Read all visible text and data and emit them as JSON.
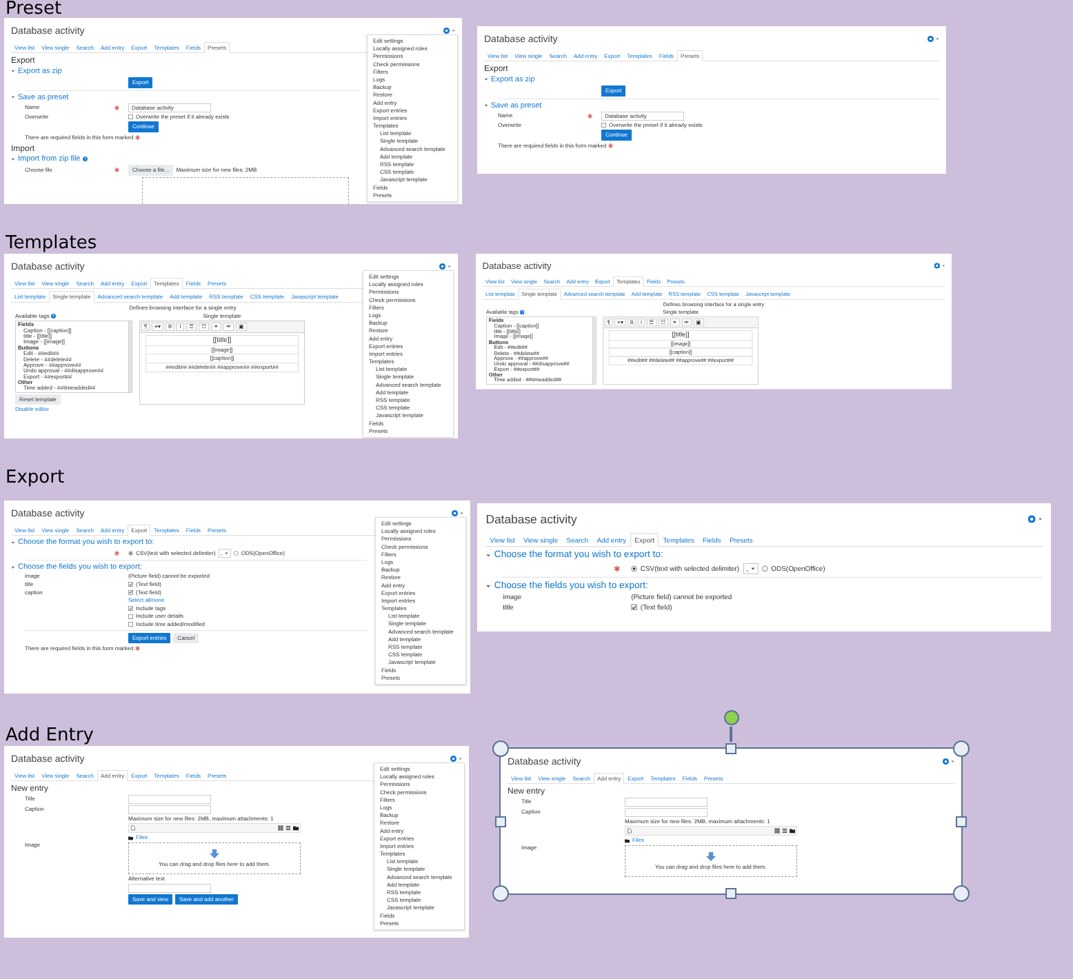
{
  "sections": [
    {
      "heading": "Preset",
      "shots": [
        {
          "title": "Database activity",
          "selected": false,
          "tabs": [
            {
              "label": "View list",
              "selected": false
            },
            {
              "label": "View single",
              "selected": false
            },
            {
              "label": "Search",
              "selected": false
            },
            {
              "label": "Add entry",
              "selected": false
            },
            {
              "label": "Export",
              "selected": false
            },
            {
              "label": "Templates",
              "selected": false
            },
            {
              "label": "Fields",
              "selected": false
            },
            {
              "label": "Presets",
              "selected": true
            }
          ],
          "blocks": [
            {
              "kind": "heading",
              "text": "Export"
            },
            {
              "kind": "section",
              "text": "Export as zip"
            },
            {
              "kind": "buttons",
              "buttons": [
                {
                  "label": "Export",
                  "primary": true
                }
              ]
            },
            {
              "kind": "divider"
            },
            {
              "kind": "section",
              "text": "Save as preset"
            },
            {
              "kind": "field",
              "label": "Name",
              "required": true,
              "value": "Database activity"
            },
            {
              "kind": "checkbox",
              "label": "Overwrite",
              "text": "Overwrite the preset if it already exists",
              "checked": false
            },
            {
              "kind": "buttons",
              "buttons": [
                {
                  "label": "Continue",
                  "primary": true
                }
              ]
            },
            {
              "kind": "note",
              "text": "There are required fields in this form marked"
            },
            {
              "kind": "heading",
              "text": "Import"
            },
            {
              "kind": "section",
              "text": "Import from zip file",
              "help": true
            },
            {
              "kind": "file",
              "label": "Choose file",
              "required": true,
              "button": "Choose a file...",
              "text": "Maximum size for new files: 2MB"
            },
            {
              "kind": "dropzone"
            }
          ],
          "menu": [
            {
              "label": "Edit settings"
            },
            {
              "label": "Locally assigned roles"
            },
            {
              "label": "Permissions"
            },
            {
              "label": "Check permissions"
            },
            {
              "label": "Filters"
            },
            {
              "label": "Logs"
            },
            {
              "label": "Backup"
            },
            {
              "label": "Restore"
            },
            {
              "label": "Add entry"
            },
            {
              "label": "Export entries"
            },
            {
              "label": "Import entries"
            },
            {
              "label": "Templates",
              "children": [
                {
                  "label": "List template"
                },
                {
                  "label": "Single template"
                },
                {
                  "label": "Advanced search template"
                },
                {
                  "label": "Add template"
                },
                {
                  "label": "RSS template"
                },
                {
                  "label": "CSS template"
                },
                {
                  "label": "Javascript template"
                }
              ]
            },
            {
              "label": "Fields"
            },
            {
              "label": "Presets"
            }
          ]
        },
        {
          "title": "Database activity",
          "selected": false,
          "tabs": [
            {
              "label": "View list",
              "selected": false
            },
            {
              "label": "View single",
              "selected": false
            },
            {
              "label": "Search",
              "selected": false
            },
            {
              "label": "Add entry",
              "selected": false
            },
            {
              "label": "Export",
              "selected": false
            },
            {
              "label": "Templates",
              "selected": false
            },
            {
              "label": "Fields",
              "selected": false
            },
            {
              "label": "Presets",
              "selected": true
            }
          ],
          "blocks": [
            {
              "kind": "heading",
              "text": "Export"
            },
            {
              "kind": "section",
              "text": "Export as zip"
            },
            {
              "kind": "buttons",
              "buttons": [
                {
                  "label": "Export",
                  "primary": true
                }
              ]
            },
            {
              "kind": "divider"
            },
            {
              "kind": "section",
              "text": "Save as preset"
            },
            {
              "kind": "field",
              "label": "Name",
              "required": true,
              "value": "Database activity"
            },
            {
              "kind": "checkbox",
              "label": "Overwrite",
              "text": "Overwrite the preset if it already exists",
              "checked": false
            },
            {
              "kind": "buttons",
              "buttons": [
                {
                  "label": "Continue",
                  "primary": true
                }
              ]
            },
            {
              "kind": "note",
              "text": "There are required fields in this form marked"
            }
          ]
        }
      ]
    },
    {
      "heading": "Templates",
      "shots": [
        {
          "title": "Database activity",
          "selected": false,
          "tabs": [
            {
              "label": "View list",
              "selected": false
            },
            {
              "label": "View single",
              "selected": false
            },
            {
              "label": "Search",
              "selected": false
            },
            {
              "label": "Add entry",
              "selected": false
            },
            {
              "label": "Export",
              "selected": false
            },
            {
              "label": "Templates",
              "selected": true
            },
            {
              "label": "Fields",
              "selected": false
            },
            {
              "label": "Presets",
              "selected": false
            }
          ],
          "subtabs": [
            {
              "label": "List template",
              "selected": false
            },
            {
              "label": "Single template",
              "selected": true
            },
            {
              "label": "Advanced search template",
              "selected": false
            },
            {
              "label": "Add template",
              "selected": false
            },
            {
              "label": "RSS template",
              "selected": false
            },
            {
              "label": "CSS template",
              "selected": false
            },
            {
              "label": "Javascript template",
              "selected": false
            }
          ],
          "blocks": [
            {
              "kind": "text",
              "text": "Defines browsing interface for a single entry"
            },
            {
              "kind": "template-editor",
              "tags_label": "Available tags",
              "tag_groups": [
                {
                  "name": "Fields",
                  "tags": [
                    "Caption - [[caption]]",
                    "title - [[title]]",
                    "Image - [[image]]"
                  ]
                },
                {
                  "name": "Buttons",
                  "tags": [
                    "Edit - ##edit##",
                    "Delete - ##delete##",
                    "Approve - ##approve##",
                    "Undo approval - ##disapprove##",
                    "Export - ##export##"
                  ]
                },
                {
                  "name": "Other",
                  "tags": [
                    "Time added - ##timeadded##"
                  ]
                }
              ],
              "editor_label": "Single template",
              "toolbar": [
                "¶",
                "≡▾",
                "B",
                "I",
                "☰",
                "☷",
                "⚭",
                "⚮",
                "▣"
              ],
              "lines": [
                "[[title]]",
                "[[image]]",
                "[[caption]]",
                "##edit## ##delete## ##approve## ##export##"
              ],
              "reset_button": "Reset template"
            },
            {
              "kind": "link",
              "text": "Disable editor"
            }
          ],
          "menu": [
            {
              "label": "Edit settings"
            },
            {
              "label": "Locally assigned roles"
            },
            {
              "label": "Permissions"
            },
            {
              "label": "Check permissions"
            },
            {
              "label": "Filters"
            },
            {
              "label": "Logs"
            },
            {
              "label": "Backup"
            },
            {
              "label": "Restore"
            },
            {
              "label": "Add entry"
            },
            {
              "label": "Export entries"
            },
            {
              "label": "Import entries"
            },
            {
              "label": "Templates",
              "children": [
                {
                  "label": "List template"
                },
                {
                  "label": "Single template"
                },
                {
                  "label": "Advanced search template"
                },
                {
                  "label": "Add template"
                },
                {
                  "label": "RSS template"
                },
                {
                  "label": "CSS template"
                },
                {
                  "label": "Javascript template"
                }
              ]
            },
            {
              "label": "Fields"
            },
            {
              "label": "Presets"
            }
          ]
        },
        {
          "title": "Database activity",
          "selected": false,
          "tabs": [
            {
              "label": "View list",
              "selected": false
            },
            {
              "label": "View single",
              "selected": false
            },
            {
              "label": "Search",
              "selected": false
            },
            {
              "label": "Add entry",
              "selected": false
            },
            {
              "label": "Export",
              "selected": false
            },
            {
              "label": "Templates",
              "selected": true
            },
            {
              "label": "Fields",
              "selected": false
            },
            {
              "label": "Presets",
              "selected": false
            }
          ],
          "subtabs": [
            {
              "label": "List template",
              "selected": false
            },
            {
              "label": "Single template",
              "selected": true
            },
            {
              "label": "Advanced search template",
              "selected": false
            },
            {
              "label": "Add template",
              "selected": false
            },
            {
              "label": "RSS template",
              "selected": false
            },
            {
              "label": "CSS template",
              "selected": false
            },
            {
              "label": "Javascript template",
              "selected": false
            }
          ],
          "blocks": [
            {
              "kind": "text",
              "text": "Defines browsing interface for a single entry"
            },
            {
              "kind": "template-editor",
              "tags_label": "Available tags",
              "tag_groups": [
                {
                  "name": "Fields",
                  "tags": [
                    "Caption - [[caption]]",
                    "title - [[title]]",
                    "Image - [[image]]"
                  ]
                },
                {
                  "name": "Buttons",
                  "tags": [
                    "Edit - ##edit##",
                    "Delete - ##delete##",
                    "Approve - ##approve##",
                    "Undo approval - ##disapprove##",
                    "Export - ##export##"
                  ]
                },
                {
                  "name": "Other",
                  "tags": [
                    "Time added - ##timeadded##"
                  ]
                }
              ],
              "editor_label": "Single template",
              "toolbar": [
                "¶",
                "≡▾",
                "B",
                "I",
                "☰",
                "☷",
                "⚭",
                "⚮",
                "▣"
              ],
              "lines": [
                "[[title]]",
                "[[image]]",
                "[[caption]]",
                "##edit## ##delete## ##approve## ##export##"
              ]
            }
          ]
        }
      ]
    },
    {
      "heading": "Export",
      "shots": [
        {
          "title": "Database activity",
          "selected": false,
          "tabs": [
            {
              "label": "View list",
              "selected": false
            },
            {
              "label": "View single",
              "selected": false
            },
            {
              "label": "Search",
              "selected": false
            },
            {
              "label": "Add entry",
              "selected": false
            },
            {
              "label": "Export",
              "selected": true
            },
            {
              "label": "Templates",
              "selected": false
            },
            {
              "label": "Fields",
              "selected": false
            },
            {
              "label": "Presets",
              "selected": false
            }
          ],
          "blocks": [
            {
              "kind": "section",
              "text": "Choose the format you wish to export to:"
            },
            {
              "kind": "format",
              "required": true,
              "options": [
                {
                  "label": "CSV(text with selected delimiter)",
                  "selected": true
                },
                {
                  "label": "ODS(OpenOffice)",
                  "selected": false
                }
              ],
              "delimiter": ","
            },
            {
              "kind": "divider"
            },
            {
              "kind": "section",
              "text": "Choose the fields you wish to export:"
            },
            {
              "kind": "info",
              "label": "image",
              "text": "(Picture field) cannot be exported"
            },
            {
              "kind": "checkbox",
              "label": "title",
              "text": "(Text field)",
              "checked": true
            },
            {
              "kind": "checkbox",
              "label": "caption",
              "text": "(Text field)",
              "checked": true
            },
            {
              "kind": "form-link",
              "text": "Select all/none"
            },
            {
              "kind": "checkbox",
              "text": "Include tags",
              "checked": true
            },
            {
              "kind": "checkbox",
              "text": "Include user details",
              "checked": false
            },
            {
              "kind": "checkbox",
              "text": "Include time added/modified",
              "checked": false
            },
            {
              "kind": "divider"
            },
            {
              "kind": "buttons",
              "buttons": [
                {
                  "label": "Export entries",
                  "primary": true
                },
                {
                  "label": "Cancel",
                  "primary": false
                }
              ]
            },
            {
              "kind": "note",
              "text": "There are required fields in this form marked"
            }
          ],
          "menu": [
            {
              "label": "Edit settings"
            },
            {
              "label": "Locally assigned roles"
            },
            {
              "label": "Permissions"
            },
            {
              "label": "Check permissions"
            },
            {
              "label": "Filters"
            },
            {
              "label": "Logs"
            },
            {
              "label": "Backup"
            },
            {
              "label": "Restore"
            },
            {
              "label": "Add entry"
            },
            {
              "label": "Export entries"
            },
            {
              "label": "Import entries"
            },
            {
              "label": "Templates",
              "children": [
                {
                  "label": "List template"
                },
                {
                  "label": "Single template"
                },
                {
                  "label": "Advanced search template"
                },
                {
                  "label": "Add template"
                },
                {
                  "label": "RSS template"
                },
                {
                  "label": "CSS template"
                },
                {
                  "label": "Javascript template"
                }
              ]
            },
            {
              "label": "Fields"
            },
            {
              "label": "Presets"
            }
          ]
        },
        {
          "title": "Database activity",
          "selected": false,
          "tabs": [
            {
              "label": "View list",
              "selected": false
            },
            {
              "label": "View single",
              "selected": false
            },
            {
              "label": "Search",
              "selected": false
            },
            {
              "label": "Add entry",
              "selected": false
            },
            {
              "label": "Export",
              "selected": true
            },
            {
              "label": "Templates",
              "selected": false
            },
            {
              "label": "Fields",
              "selected": false
            },
            {
              "label": "Presets",
              "selected": false
            }
          ],
          "blocks": [
            {
              "kind": "section",
              "text": "Choose the format you wish to export to:"
            },
            {
              "kind": "format",
              "required": true,
              "options": [
                {
                  "label": "CSV(text with selected delimiter)",
                  "selected": true
                },
                {
                  "label": "ODS(OpenOffice)",
                  "selected": false
                }
              ],
              "delimiter": ","
            },
            {
              "kind": "divider"
            },
            {
              "kind": "section",
              "text": "Choose the fields you wish to export:"
            },
            {
              "kind": "info",
              "label": "image",
              "text": "(Picture field) cannot be exported"
            },
            {
              "kind": "checkbox",
              "label": "title",
              "text": "(Text field)",
              "checked": true
            }
          ]
        }
      ]
    },
    {
      "heading": "Add Entry",
      "shots": [
        {
          "title": "Database activity",
          "selected": false,
          "tabs": [
            {
              "label": "View list",
              "selected": false
            },
            {
              "label": "View single",
              "selected": false
            },
            {
              "label": "Search",
              "selected": false
            },
            {
              "label": "Add entry",
              "selected": true
            },
            {
              "label": "Export",
              "selected": false
            },
            {
              "label": "Templates",
              "selected": false
            },
            {
              "label": "Fields",
              "selected": false
            },
            {
              "label": "Presets",
              "selected": false
            }
          ],
          "blocks": [
            {
              "kind": "heading",
              "text": "New entry"
            },
            {
              "kind": "field",
              "label": "Title"
            },
            {
              "kind": "field",
              "label": "Caption"
            },
            {
              "kind": "filepicker",
              "label": "Image",
              "text": "Maximum size for new files: 2MB, maximum attachments: 1",
              "files": "Files",
              "drop": "You can drag and drop files here to add them."
            },
            {
              "kind": "field",
              "caption": "Alternative text"
            },
            {
              "kind": "buttons",
              "buttons": [
                {
                  "label": "Save and view",
                  "primary": true
                },
                {
                  "label": "Save and add another",
                  "primary": true
                }
              ]
            }
          ],
          "menu": [
            {
              "label": "Edit settings"
            },
            {
              "label": "Locally assigned roles"
            },
            {
              "label": "Permissions"
            },
            {
              "label": "Check permissions"
            },
            {
              "label": "Filters"
            },
            {
              "label": "Logs"
            },
            {
              "label": "Backup"
            },
            {
              "label": "Restore"
            },
            {
              "label": "Add entry"
            },
            {
              "label": "Export entries"
            },
            {
              "label": "Import entries"
            },
            {
              "label": "Templates",
              "children": [
                {
                  "label": "List template"
                },
                {
                  "label": "Single template"
                },
                {
                  "label": "Advanced search template"
                },
                {
                  "label": "Add template"
                },
                {
                  "label": "RSS template"
                },
                {
                  "label": "CSS template"
                },
                {
                  "label": "Javascript template"
                }
              ]
            },
            {
              "label": "Fields"
            },
            {
              "label": "Presets"
            }
          ]
        },
        {
          "title": "Database activity",
          "selected": true,
          "tabs": [
            {
              "label": "View list",
              "selected": false
            },
            {
              "label": "View single",
              "selected": false
            },
            {
              "label": "Search",
              "selected": false
            },
            {
              "label": "Add entry",
              "selected": true
            },
            {
              "label": "Export",
              "selected": false
            },
            {
              "label": "Templates",
              "selected": false
            },
            {
              "label": "Fields",
              "selected": false
            },
            {
              "label": "Presets",
              "selected": false
            }
          ],
          "blocks": [
            {
              "kind": "heading",
              "text": "New entry"
            },
            {
              "kind": "field",
              "label": "Title"
            },
            {
              "kind": "field",
              "label": "Caption"
            },
            {
              "kind": "filepicker",
              "label": "Image",
              "text": "Maximum size for new files: 2MB, maximum attachments: 1",
              "files": "Files",
              "drop": "You can drag and drop files here to add them."
            }
          ]
        }
      ]
    }
  ]
}
